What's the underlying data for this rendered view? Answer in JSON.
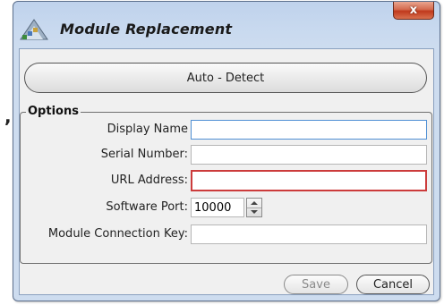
{
  "window": {
    "title": "Module Replacement",
    "close_glyph": "x",
    "app_icon": "module-logo-icon"
  },
  "stray_mark": ",",
  "auto_detect": {
    "label": "Auto - Detect"
  },
  "options": {
    "legend": "Options",
    "fields": {
      "display_name": {
        "label": "Display Name",
        "value": ""
      },
      "serial_number": {
        "label": "Serial Number:",
        "value": ""
      },
      "url_address": {
        "label": "URL Address:",
        "value": ""
      },
      "software_port": {
        "label": "Software Port:",
        "value": "10000"
      },
      "connection_key": {
        "label": "Module Connection Key:",
        "value": ""
      }
    }
  },
  "buttons": {
    "save": "Save",
    "cancel": "Cancel"
  },
  "colors": {
    "titlebar": "#c8d9ef",
    "client": "#f0f0f0",
    "close": "#c0391c",
    "focus_border": "#4f8fd4",
    "error_border": "#cc3b3b"
  }
}
